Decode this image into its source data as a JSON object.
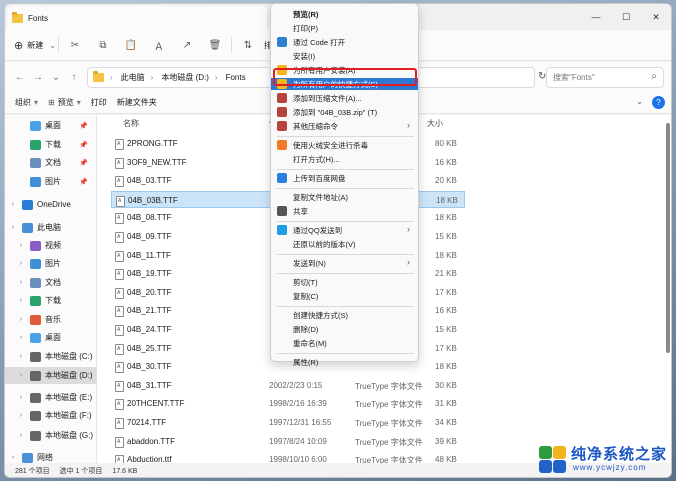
{
  "window": {
    "title": "Fonts",
    "controls": [
      "—",
      "☐",
      "✕"
    ]
  },
  "toolbar": {
    "new_label": "新建",
    "sort_label": "排"
  },
  "address": {
    "crumbs": [
      "此电脑",
      "本地磁盘 (D:)",
      "Fonts"
    ],
    "search_placeholder": "搜索\"Fonts\""
  },
  "commands": {
    "organize": "组织",
    "preview": "预览",
    "print": "打印",
    "new_folder": "新建文件夹"
  },
  "columns": {
    "name": "名称",
    "date": "修",
    "type": "类型",
    "size": "大小"
  },
  "sidebar": {
    "items": [
      {
        "label": "桌面",
        "pinned": true,
        "color": "#4aa3e8"
      },
      {
        "label": "下载",
        "pinned": true,
        "color": "#2aa36b"
      },
      {
        "label": "文档",
        "pinned": true,
        "color": "#6a8fbf"
      },
      {
        "label": "图片",
        "pinned": true,
        "color": "#3e8fd6"
      },
      {
        "label": "OneDrive",
        "pinned": false,
        "color": "#2b7cd3"
      },
      {
        "label": "此电脑",
        "pinned": false,
        "color": "#4a90d9"
      },
      {
        "label": "视频",
        "pinned": false,
        "color": "#8b5cc4"
      },
      {
        "label": "图片",
        "pinned": false,
        "color": "#3e8fd6"
      },
      {
        "label": "文档",
        "pinned": false,
        "color": "#6a8fbf"
      },
      {
        "label": "下载",
        "pinned": false,
        "color": "#2aa36b"
      },
      {
        "label": "音乐",
        "pinned": false,
        "color": "#e05a3a"
      },
      {
        "label": "桌面",
        "pinned": false,
        "color": "#4aa3e8"
      },
      {
        "label": "本地磁盘 (C:)",
        "pinned": false,
        "color": "#666666"
      },
      {
        "label": "本地磁盘 (D:)",
        "pinned": false,
        "color": "#666666"
      },
      {
        "label": "本地磁盘 (E:)",
        "pinned": false,
        "color": "#666666"
      },
      {
        "label": "本地磁盘 (F:)",
        "pinned": false,
        "color": "#666666"
      },
      {
        "label": "本地磁盘 (G:)",
        "pinned": false,
        "color": "#666666"
      },
      {
        "label": "网络",
        "pinned": false,
        "color": "#4a90d9"
      }
    ]
  },
  "files": [
    {
      "name": "2PRONG.TTF",
      "date": "",
      "type": "",
      "size": "80 KB"
    },
    {
      "name": "3OF9_NEW.TTF",
      "date": "",
      "type": "",
      "size": "16 KB"
    },
    {
      "name": "04B_03.TTF",
      "date": "",
      "type": "",
      "size": "20 KB"
    },
    {
      "name": "04B_03B.TTF",
      "date": "20",
      "type": "",
      "size": "18 KB"
    },
    {
      "name": "04B_08.TTF",
      "date": "",
      "type": "",
      "size": "18 KB"
    },
    {
      "name": "04B_09.TTF",
      "date": "",
      "type": "",
      "size": "15 KB"
    },
    {
      "name": "04B_11.TTF",
      "date": "",
      "type": "",
      "size": "18 KB"
    },
    {
      "name": "04B_19.TTF",
      "date": "",
      "type": "",
      "size": "21 KB"
    },
    {
      "name": "04B_20.TTF",
      "date": "",
      "type": "",
      "size": "17 KB"
    },
    {
      "name": "04B_21.TTF",
      "date": "",
      "type": "",
      "size": "16 KB"
    },
    {
      "name": "04B_24.TTF",
      "date": "",
      "type": "",
      "size": "15 KB"
    },
    {
      "name": "04B_25.TTF",
      "date": "",
      "type": "",
      "size": "17 KB"
    },
    {
      "name": "04B_30.TTF",
      "date": "",
      "type": "",
      "size": "18 KB"
    },
    {
      "name": "04B_31.TTF",
      "date": "2002/2/23 0:15",
      "type": "TrueType 字体文件",
      "size": "30 KB"
    },
    {
      "name": "20THCENT.TTF",
      "date": "1998/2/16 16:39",
      "type": "TrueType 字体文件",
      "size": "31 KB"
    },
    {
      "name": "70214.TTF",
      "date": "1997/12/31 16:55",
      "type": "TrueType 字体文件",
      "size": "34 KB"
    },
    {
      "name": "abaddon.TTF",
      "date": "1997/8/24 10:09",
      "type": "TrueType 字体文件",
      "size": "39 KB"
    },
    {
      "name": "Abduction.ttf",
      "date": "1998/10/10 6:00",
      "type": "TrueType 字体文件",
      "size": "48 KB"
    }
  ],
  "selected_file_index": 3,
  "context_menu": {
    "groups": [
      [
        {
          "label": "预览(R)",
          "bold": true,
          "icon": "",
          "arrow": false
        },
        {
          "label": "打印(P)",
          "icon": "",
          "arrow": false
        },
        {
          "label": "通过 Code 打开",
          "icon": "vscode-icon",
          "arrow": false
        },
        {
          "label": "安装(I)",
          "icon": "",
          "arrow": false
        },
        {
          "label": "为所有用户安装(A)",
          "icon": "shield-icon",
          "arrow": false
        },
        {
          "label": "为所有用户的快捷方式(S)",
          "icon": "shield-icon",
          "arrow": false,
          "highlight": true
        },
        {
          "label": "添加到压缩文件(A)...",
          "icon": "archive-icon",
          "arrow": false
        },
        {
          "label": "添加到 \"04B_03B.zip\" (T)",
          "icon": "archive-icon",
          "arrow": false
        },
        {
          "label": "其他压缩命令",
          "icon": "archive-icon",
          "arrow": true
        }
      ],
      [
        {
          "label": "使用火绒安全进行杀毒",
          "icon": "huorong-icon",
          "arrow": false
        },
        {
          "label": "打开方式(H)...",
          "icon": "",
          "arrow": false
        }
      ],
      [
        {
          "label": "上传到百度网盘",
          "icon": "baidu-icon",
          "arrow": false
        }
      ],
      [
        {
          "label": "复制文件地址(A)",
          "icon": "",
          "arrow": false
        },
        {
          "label": "共享",
          "icon": "share-icon",
          "arrow": false
        }
      ],
      [
        {
          "label": "通过QQ发送到",
          "icon": "qq-icon",
          "arrow": true
        },
        {
          "label": "还原以前的版本(V)",
          "icon": "",
          "arrow": false
        }
      ],
      [
        {
          "label": "发送到(N)",
          "icon": "",
          "arrow": true
        }
      ],
      [
        {
          "label": "剪切(T)",
          "icon": "",
          "arrow": false
        },
        {
          "label": "复制(C)",
          "icon": "",
          "arrow": false
        }
      ],
      [
        {
          "label": "创建快捷方式(S)",
          "icon": "",
          "arrow": false
        },
        {
          "label": "删除(D)",
          "icon": "",
          "arrow": false
        },
        {
          "label": "重命名(M)",
          "icon": "",
          "arrow": false
        }
      ],
      [
        {
          "label": "属性(R)",
          "icon": "",
          "arrow": false
        }
      ]
    ]
  },
  "status": {
    "count": "281 个项目",
    "selected": "选中 1 个项目",
    "size": "17.6 KB"
  },
  "watermark": {
    "title": "纯净系统之家",
    "url": "www.ycwjzy.com"
  }
}
